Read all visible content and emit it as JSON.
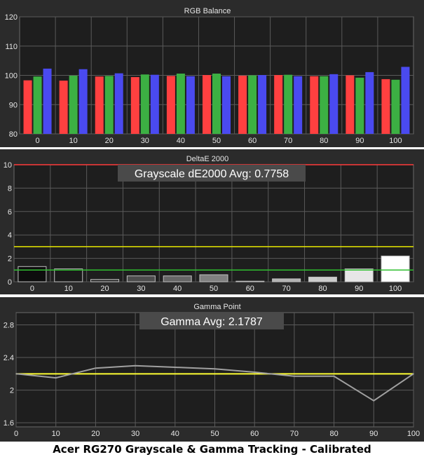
{
  "caption": "Acer RG270 Grayscale & Gamma Tracking - Calibrated",
  "colors": {
    "panel_bg": "#2b2b2b",
    "plot_bg": "#1e1e1e",
    "grid": "#5a5a5a",
    "text": "#e6e6e6",
    "red": "#ff4040",
    "green": "#3cb043",
    "blue": "#4a4af0",
    "threshold_red": "#ff3b3b",
    "threshold_yellow": "#e8e800",
    "threshold_green": "#2fbf2f",
    "gamma_line": "#a0a0a0",
    "gamma_target": "#ffff33",
    "annotation_bg": "#4a4a4a"
  },
  "chart_data": [
    {
      "type": "bar",
      "title": "RGB Balance",
      "categories": [
        "0",
        "10",
        "20",
        "30",
        "40",
        "50",
        "60",
        "70",
        "80",
        "90",
        "100"
      ],
      "series": [
        {
          "name": "",
          "color": "red",
          "values": [
            98.3,
            98.2,
            99.6,
            99.4,
            99.8,
            100.1,
            99.9,
            100.1,
            99.7,
            100.0,
            98.7
          ]
        },
        {
          "name": "",
          "color": "green",
          "values": [
            99.6,
            99.9,
            99.8,
            100.3,
            100.6,
            100.6,
            100.0,
            100.2,
            99.7,
            99.2,
            98.5
          ]
        },
        {
          "name": "",
          "color": "blue",
          "values": [
            102.3,
            102.1,
            100.7,
            100.2,
            99.7,
            99.7,
            100.1,
            99.7,
            100.4,
            101.1,
            102.9
          ]
        }
      ],
      "ylim": [
        80,
        120
      ],
      "yticks": [
        "80",
        "90",
        "100",
        "110",
        "120"
      ],
      "grid": true
    },
    {
      "type": "bar",
      "title": "DeltaE 2000",
      "annotation": "Grayscale dE2000 Avg: 0.7758",
      "categories": [
        "0",
        "10",
        "20",
        "30",
        "40",
        "50",
        "60",
        "70",
        "80",
        "90",
        "100"
      ],
      "values": [
        1.3,
        1.1,
        0.2,
        0.5,
        0.5,
        0.6,
        0.05,
        0.25,
        0.4,
        1.1,
        2.2
      ],
      "ylim": [
        0,
        10
      ],
      "yticks": [
        "0",
        "2",
        "4",
        "6",
        "8",
        "10"
      ],
      "thresholds": [
        {
          "value": 10,
          "color": "threshold_red"
        },
        {
          "value": 3,
          "color": "threshold_yellow"
        },
        {
          "value": 1,
          "color": "threshold_green"
        }
      ],
      "grid": true
    },
    {
      "type": "line",
      "title": "Gamma Point",
      "annotation": "Gamma Avg: 2.1787",
      "x": [
        0,
        10,
        20,
        30,
        40,
        50,
        60,
        70,
        80,
        90,
        100
      ],
      "xticks": [
        "0",
        "10",
        "20",
        "30",
        "40",
        "50",
        "60",
        "70",
        "80",
        "90",
        "100"
      ],
      "y": [
        2.2,
        2.15,
        2.27,
        2.3,
        2.28,
        2.26,
        2.22,
        2.17,
        2.17,
        1.87,
        2.2
      ],
      "target": 2.2,
      "xlim": [
        0,
        100
      ],
      "ylim": [
        1.55,
        2.95
      ],
      "yticks": [
        1.6,
        2.0,
        2.4,
        2.8
      ],
      "ytick_labels": [
        "1.6",
        "2",
        "2.4",
        "2.8"
      ],
      "grid": true
    }
  ]
}
